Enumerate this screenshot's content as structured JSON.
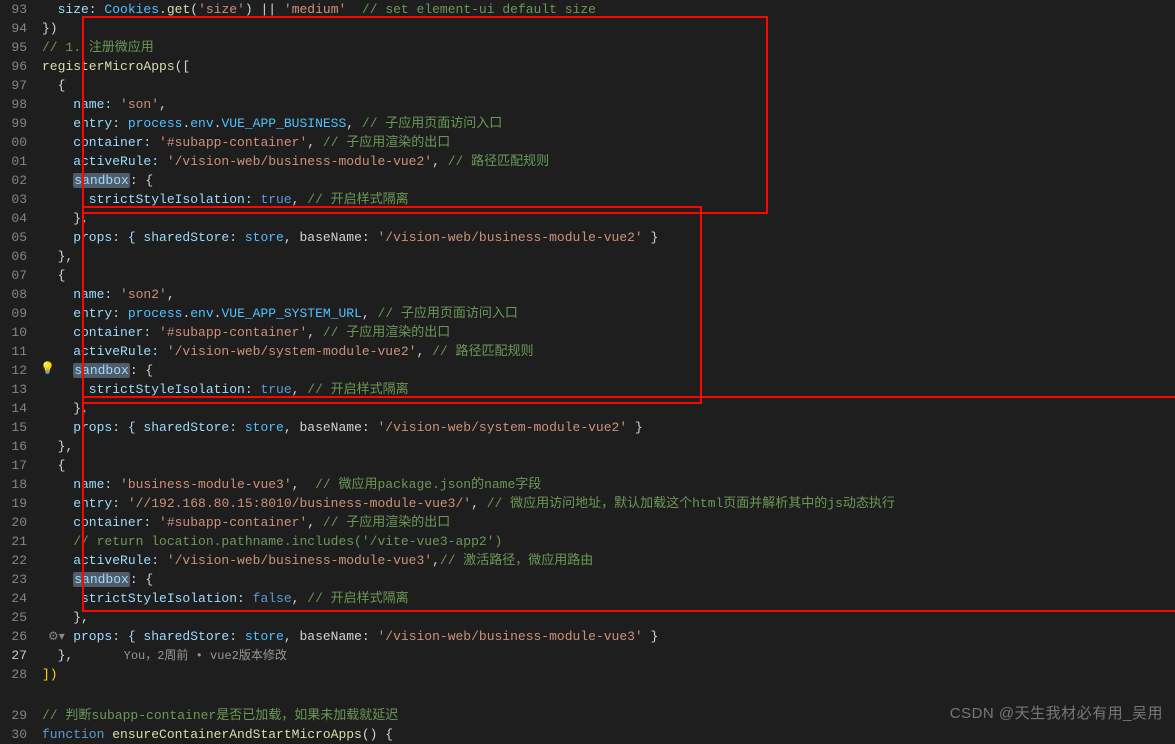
{
  "watermark": "CSDN @天生我材必有用_吴用",
  "lines": {
    "93": "93",
    "94": "94",
    "95": "95",
    "96": "96",
    "97": "97",
    "98": "98",
    "99": "99",
    "00": "00",
    "01": "01",
    "02": "02",
    "03": "03",
    "04": "04",
    "05": "05",
    "06": "06",
    "07": "07",
    "08": "08",
    "09": "09",
    "10": "10",
    "11": "11",
    "12": "12",
    "13": "13",
    "14": "14",
    "15": "15",
    "16": "16",
    "17": "17",
    "18": "18",
    "19": "19",
    "20": "20",
    "21": "21",
    "22": "22",
    "23": "23",
    "24": "24",
    "25": "25",
    "26": "26",
    "27": "27",
    "28": "28",
    "29": "29",
    "30": "30"
  },
  "code": {
    "l93_a": "  size: ",
    "l93_b": "Cookies",
    "l93_c": ".",
    "l93_d": "get",
    "l93_e": "(",
    "l93_f": "'size'",
    "l93_g": ") || ",
    "l93_h": "'medium'",
    "l93_i": "  // set element-ui default size",
    "l94": "})",
    "l95": "// 1. 注册微应用",
    "l96_a": "registerMicroApps",
    "l96_b": "([",
    "l97": "  {",
    "l98_a": "    name: ",
    "l98_b": "'son'",
    "l98_c": ",",
    "l99_a": "    entry: ",
    "l99_b": "process",
    "l99_c": ".",
    "l99_d": "env",
    "l99_e": ".",
    "l99_f": "VUE_APP_BUSINESS",
    "l99_g": ", ",
    "l99_h": "// 子应用页面访问入口",
    "l100_a": "    container: ",
    "l100_b": "'#subapp-container'",
    "l100_c": ", ",
    "l100_d": "// 子应用渲染的出口",
    "l101_a": "    activeRule: ",
    "l101_b": "'/vision-web/business-module-vue2'",
    "l101_c": ", ",
    "l101_d": "// 路径匹配规则",
    "l102_a": "    ",
    "l102_b": "sandbox",
    "l102_c": ": {",
    "l103_a": "      strictStyleIsolation: ",
    "l103_b": "true",
    "l103_c": ", ",
    "l103_d": "// 开启样式隔离",
    "l104": "    },",
    "l105_a": "    props: { sharedStore: ",
    "l105_b": "store",
    "l105_c": ", baseName: ",
    "l105_d": "'/vision-web/business-module-vue2'",
    "l105_e": " }",
    "l106": "  },",
    "l107": "  {",
    "l108_a": "    name: ",
    "l108_b": "'son2'",
    "l108_c": ",",
    "l109_a": "    entry: ",
    "l109_b": "process",
    "l109_c": ".",
    "l109_d": "env",
    "l109_e": ".",
    "l109_f": "VUE_APP_SYSTEM_URL",
    "l109_g": ", ",
    "l109_h": "// 子应用页面访问入口",
    "l110_a": "    container: ",
    "l110_b": "'#subapp-container'",
    "l110_c": ", ",
    "l110_d": "// 子应用渲染的出口",
    "l111_a": "    activeRule: ",
    "l111_b": "'/vision-web/system-module-vue2'",
    "l111_c": ", ",
    "l111_d": "// 路径匹配规则",
    "l112_a": "    ",
    "l112_b": "sandbox",
    "l112_c": ": {",
    "l113_a": "      strictStyleIsolation: ",
    "l113_b": "true",
    "l113_c": ", ",
    "l113_d": "// 开启样式隔离",
    "l114": "    },",
    "l115_a": "    props: { sharedStore: ",
    "l115_b": "store",
    "l115_c": ", baseName: ",
    "l115_d": "'/vision-web/system-module-vue2'",
    "l115_e": " }",
    "l116": "  },",
    "l117": "  {",
    "l118_a": "    name: ",
    "l118_b": "'business-module-vue3'",
    "l118_c": ",  ",
    "l118_d": "// 微应用package.json的name字段",
    "l119_a": "    entry: ",
    "l119_b": "'//192.168.80.15:8010/business-module-vue3/'",
    "l119_c": ", ",
    "l119_d": "// 微应用访问地址，默认加载这个html页面并解析其中的js动态执行",
    "l120_a": "    container: ",
    "l120_b": "'#subapp-container'",
    "l120_c": ", ",
    "l120_d": "// 子应用渲染的出口",
    "l121": "    // return location.pathname.includes('/vite-vue3-app2')",
    "l122_a": "    activeRule: ",
    "l122_b": "'/vision-web/business-module-vue3'",
    "l122_c": ",",
    "l122_d": "// 激活路径，微应用路由",
    "l123_a": "    ",
    "l123_b": "sandbox",
    "l123_c": ": {",
    "l124_a": "     strictStyleIsolation: ",
    "l124_b": "false",
    "l124_c": ", ",
    "l124_d": "// 开启样式隔离",
    "l125": "    },",
    "l126_a": "    props: { sharedStore: ",
    "l126_b": "store",
    "l126_c": ", baseName: ",
    "l126_d": "'/vision-web/business-module-vue3'",
    "l126_e": " }",
    "l127_a": "  },",
    "l127_b": "       You，2周前 • vue2版本修改",
    "l128": "])",
    "l129": "// 判断subapp-container是否已加载，如果未加载就延迟",
    "l130_a": "function ",
    "l130_b": "ensureContainerAndStartMicroApps",
    "l130_c": "() {"
  }
}
